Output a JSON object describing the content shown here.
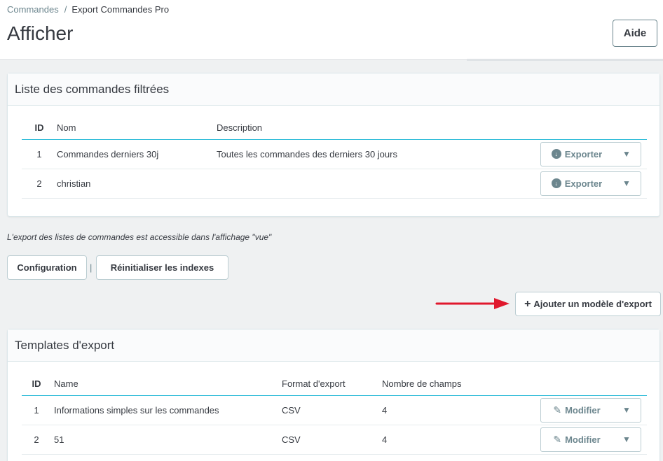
{
  "breadcrumb": {
    "parent": "Commandes",
    "separator": "/",
    "current": "Export Commandes Pro"
  },
  "page_title": "Afficher",
  "help_button": "Aide",
  "orders_panel": {
    "title": "Liste des commandes filtrées",
    "columns": {
      "id": "ID",
      "name": "Nom",
      "description": "Description"
    },
    "rows": [
      {
        "id": "1",
        "name": "Commandes derniers 30j",
        "description": "Toutes les commandes des derniers 30 jours",
        "action": "Exporter"
      },
      {
        "id": "2",
        "name": "christian",
        "description": "",
        "action": "Exporter"
      }
    ]
  },
  "note": "L'export des listes de commandes est accessible dans l'affichage \"vue\"",
  "toolbar": {
    "configuration": "Configuration",
    "separator": "|",
    "reset_indexes": "Réinitialiser les indexes"
  },
  "add_template_button": "Ajouter un modèle d'export",
  "templates_panel": {
    "title": "Templates d'export",
    "columns": {
      "id": "ID",
      "name": "Name",
      "format": "Format d'export",
      "fields": "Nombre de champs"
    },
    "rows": [
      {
        "id": "1",
        "name": "Informations simples sur les commandes",
        "format": "CSV",
        "fields": "4",
        "action": "Modifier"
      },
      {
        "id": "2",
        "name": "51",
        "format": "CSV",
        "fields": "4",
        "action": "Modifier"
      }
    ]
  },
  "colors": {
    "accent": "#25b9d7",
    "arrow": "#e0182d",
    "text": "#363a41",
    "muted": "#6c868e"
  }
}
